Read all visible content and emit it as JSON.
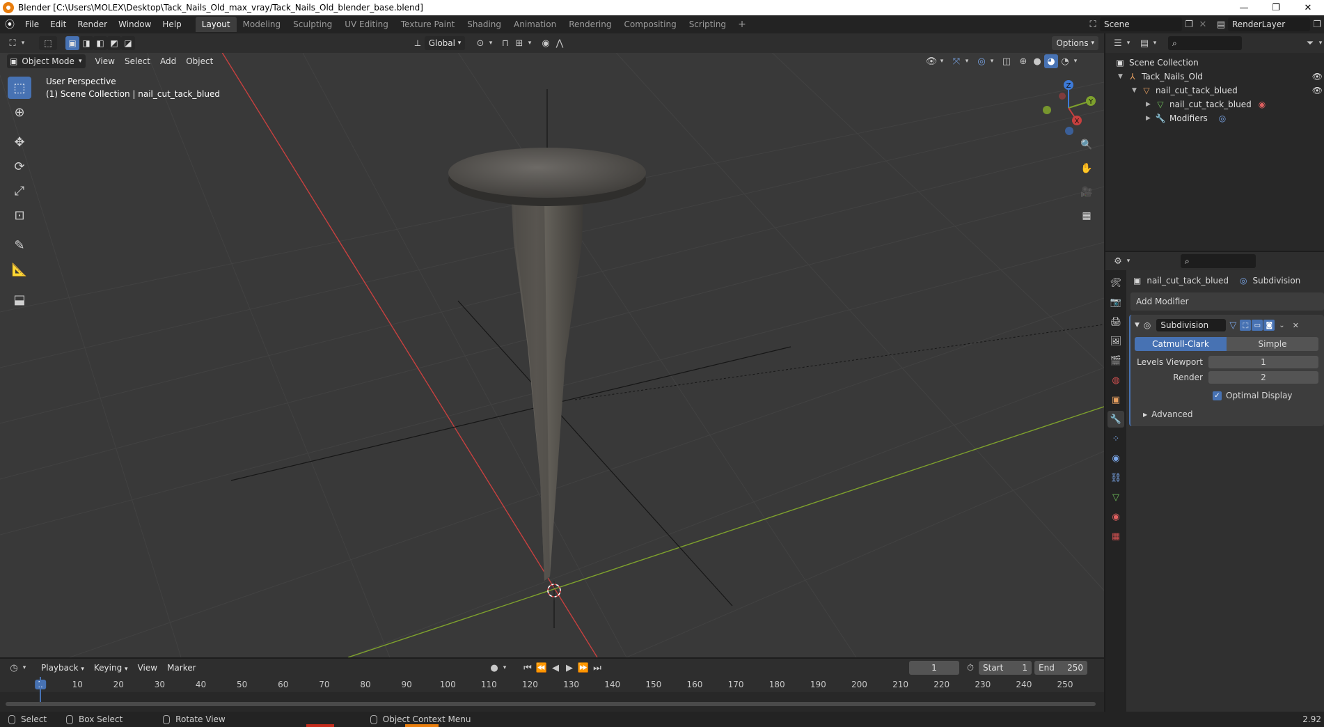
{
  "window": {
    "title": "Blender [C:\\Users\\MOLEX\\Desktop\\Tack_Nails_Old_max_vray/Tack_Nails_Old_blender_base.blend]",
    "minimize": "—",
    "restore": "❐",
    "close": "✕"
  },
  "menu": [
    "File",
    "Edit",
    "Render",
    "Window",
    "Help"
  ],
  "workspaces": [
    "Layout",
    "Modeling",
    "Sculpting",
    "UV Editing",
    "Texture Paint",
    "Shading",
    "Animation",
    "Rendering",
    "Compositing",
    "Scripting"
  ],
  "workspace_active": "Layout",
  "scene": {
    "name": "Scene",
    "render_layer": "RenderLayer"
  },
  "viewport": {
    "mode": "Object Mode",
    "menus": [
      "View",
      "Select",
      "Add",
      "Object"
    ],
    "transform_orientation": "Global",
    "options_label": "Options",
    "perspective_label": "User Perspective",
    "collection_label": "(1) Scene Collection | nail_cut_tack_blued"
  },
  "gizmo": {
    "x": "X",
    "y": "Y",
    "z": "Z"
  },
  "outliner": {
    "root": "Scene Collection",
    "items": [
      {
        "label": "Tack_Nails_Old",
        "depth": 1
      },
      {
        "label": "nail_cut_tack_blued",
        "depth": 2
      },
      {
        "label": "nail_cut_tack_blued",
        "depth": 3
      },
      {
        "label": "Modifiers",
        "depth": 3
      }
    ]
  },
  "properties": {
    "object_name": "nail_cut_tack_blued",
    "modifier_breadcrumb": "Subdivision",
    "add_modifier": "Add Modifier",
    "modifier": {
      "name": "Subdivision",
      "modes": [
        "Catmull-Clark",
        "Simple"
      ],
      "active_mode": "Catmull-Clark",
      "levels_viewport_label": "Levels Viewport",
      "levels_viewport": "1",
      "render_label": "Render",
      "render": "2",
      "optimal_display_label": "Optimal Display",
      "optimal_display": true,
      "advanced_label": "Advanced"
    }
  },
  "timeline": {
    "menus": [
      "Playback",
      "Keying",
      "View",
      "Marker"
    ],
    "current_frame": "1",
    "start_label": "Start",
    "start": "1",
    "end_label": "End",
    "end": "250",
    "ticks": [
      "1",
      "10",
      "20",
      "30",
      "40",
      "50",
      "60",
      "70",
      "80",
      "90",
      "100",
      "110",
      "120",
      "130",
      "140",
      "150",
      "160",
      "170",
      "180",
      "190",
      "200",
      "210",
      "220",
      "230",
      "240",
      "250"
    ]
  },
  "statusbar": {
    "select": "Select",
    "box_select": "Box Select",
    "rotate_view": "Rotate View",
    "context_menu": "Object Context Menu",
    "version": "2.92"
  },
  "colors": {
    "accent": "#4772b3",
    "x_axis": "#c8403f",
    "y_axis": "#7ea12d",
    "z_axis": "#3d7ad8",
    "brand": "#e87d0d"
  }
}
